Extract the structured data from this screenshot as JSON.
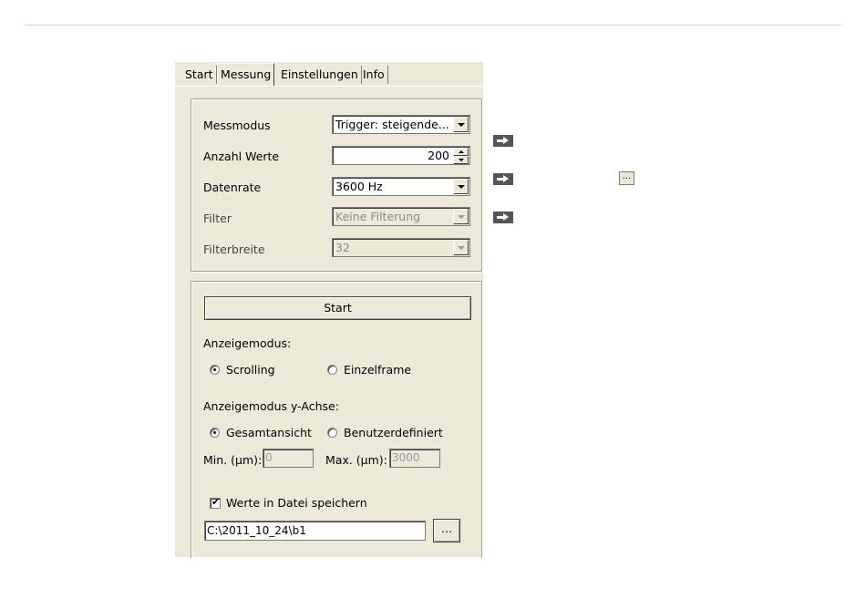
{
  "tabs": [
    {
      "label": "Start"
    },
    {
      "label": "Messung"
    },
    {
      "label": "Einstellungen"
    },
    {
      "label": "Info"
    }
  ],
  "settings": {
    "messmodus": {
      "label": "Messmodus",
      "value": "Trigger: steigende..."
    },
    "anzahl_werte": {
      "label": "Anzahl Werte",
      "value": "200"
    },
    "datenrate": {
      "label": "Datenrate",
      "value": "3600 Hz"
    },
    "filter": {
      "label": "Filter",
      "value": "Keine Filterung"
    },
    "filterbreite": {
      "label": "Filterbreite",
      "value": "32"
    }
  },
  "measure": {
    "start_label": "Start",
    "anzeigemodus_label": "Anzeigemodus:",
    "scrolling_label": "Scrolling",
    "einzelframe_label": "Einzelframe",
    "y_axis_label": "Anzeigemodus y-Achse:",
    "gesamtansicht_label": "Gesamtansicht",
    "benutzerdefiniert_label": "Benutzerdefiniert",
    "min_label": "Min. (µm):",
    "min_value": "0",
    "max_label": "Max. (µm):",
    "max_value": "3000",
    "save_label": "Werte in Datei speichern",
    "file_path": "C:\\2011_10_24\\b1",
    "browse_label": "...",
    "check_mark": "✔"
  },
  "annotation": {
    "mini_button_label": "..."
  }
}
